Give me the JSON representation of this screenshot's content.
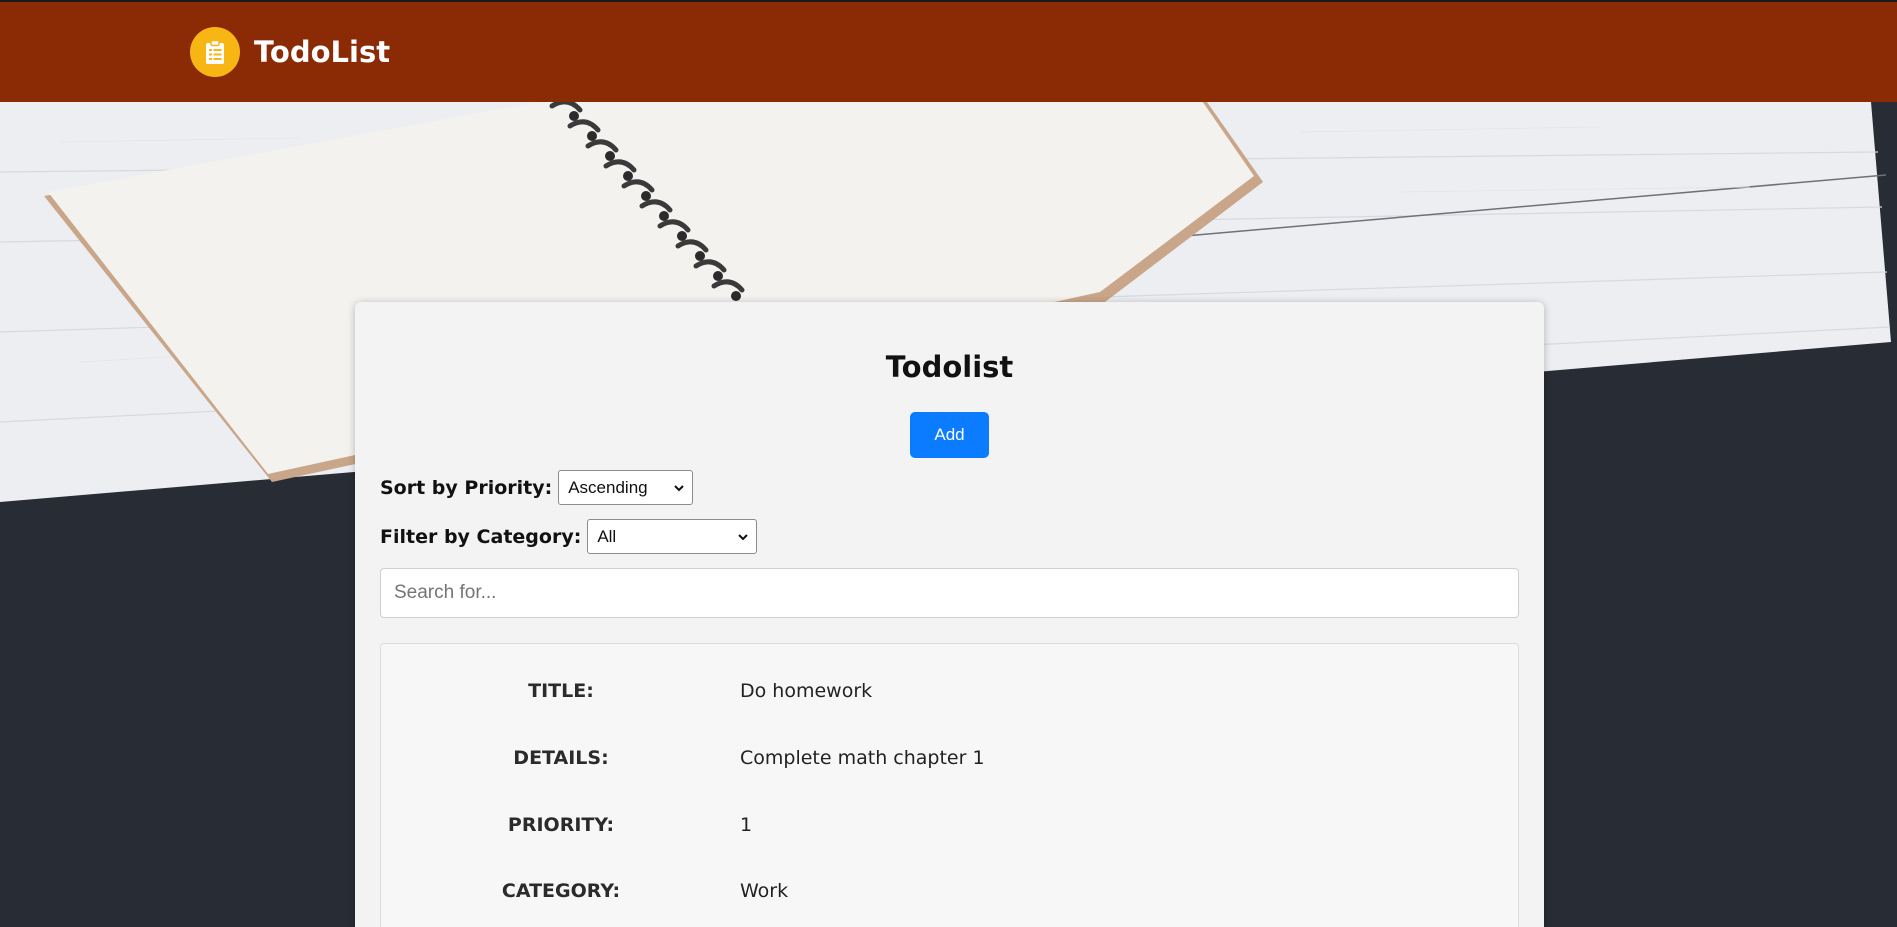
{
  "header": {
    "brand_name": "TodoList",
    "brand_color": "#8a2b06",
    "logo_icon": "clipboard-icon",
    "logo_color": "#f7b614"
  },
  "main": {
    "title": "Todolist",
    "add_label": "Add",
    "sort": {
      "label": "Sort by Priority:",
      "selected": "Ascending"
    },
    "filter": {
      "label": "Filter by Category:",
      "selected": "All"
    },
    "search": {
      "placeholder": "Search for...",
      "value": ""
    },
    "todo": {
      "title_label": "TITLE:",
      "title_value": "Do homework",
      "details_label": "DETAILS:",
      "details_value": "Complete math chapter 1",
      "priority_label": "PRIORITY:",
      "priority_value": "1",
      "category_label": "CATEGORY:",
      "category_value": "Work"
    }
  },
  "colors": {
    "page_background": "#282c34",
    "card_background": "#f3f3f3",
    "button_primary": "#0b7bff"
  }
}
